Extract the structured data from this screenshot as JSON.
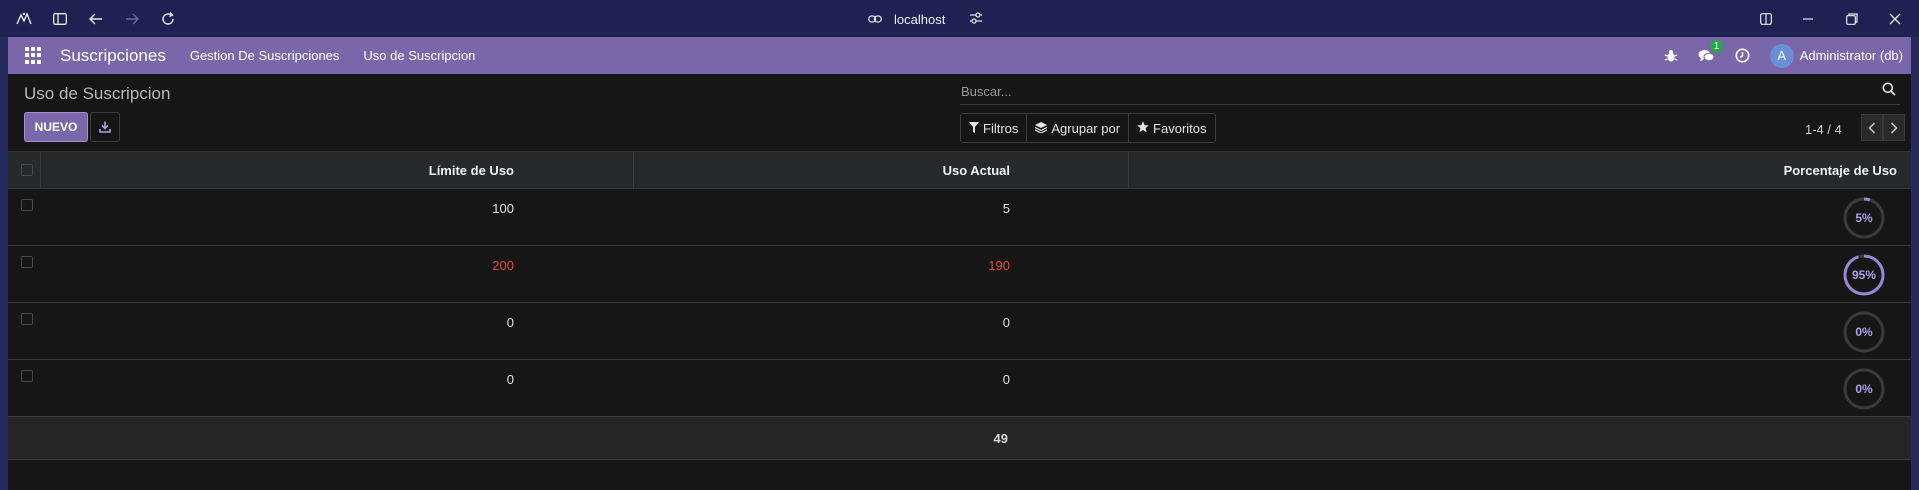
{
  "browser": {
    "url": "localhost",
    "icons": [
      "bird-logo-icon",
      "sidebar-toggle-icon",
      "back-icon",
      "forward-icon",
      "reload-icon",
      "link-icon",
      "site-settings-icon",
      "split-view-icon",
      "minimize-icon",
      "restore-icon",
      "close-icon"
    ]
  },
  "navbar": {
    "app_name": "Suscripciones",
    "menu": [
      "Gestion De Suscripciones",
      "Uso de Suscripcion"
    ],
    "chat_count": "1",
    "avatar_letter": "A",
    "user": "Administrator (db)",
    "color": "#7967a9"
  },
  "control_panel": {
    "title": "Uso de Suscripcion",
    "new_label": "NUEVO",
    "search_placeholder": "Buscar...",
    "filters_label": "Filtros",
    "group_label": "Agrupar por",
    "favorites_label": "Favoritos",
    "pager": "1-4 / 4"
  },
  "table": {
    "columns": [
      "Límite de Uso",
      "Uso Actual",
      "Porcentaje de Uso"
    ],
    "rows": [
      {
        "limit": "100",
        "current": "5",
        "percent_label": "5%",
        "percent": 5,
        "danger": false
      },
      {
        "limit": "200",
        "current": "190",
        "percent_label": "95%",
        "percent": 95,
        "danger": true
      },
      {
        "limit": "0",
        "current": "0",
        "percent_label": "0%",
        "percent": 0,
        "danger": false
      },
      {
        "limit": "0",
        "current": "0",
        "percent_label": "0%",
        "percent": 0,
        "danger": false
      }
    ],
    "footer_sum": "49",
    "danger_color": "#e8493f",
    "progress_color": "#9a86d6"
  }
}
